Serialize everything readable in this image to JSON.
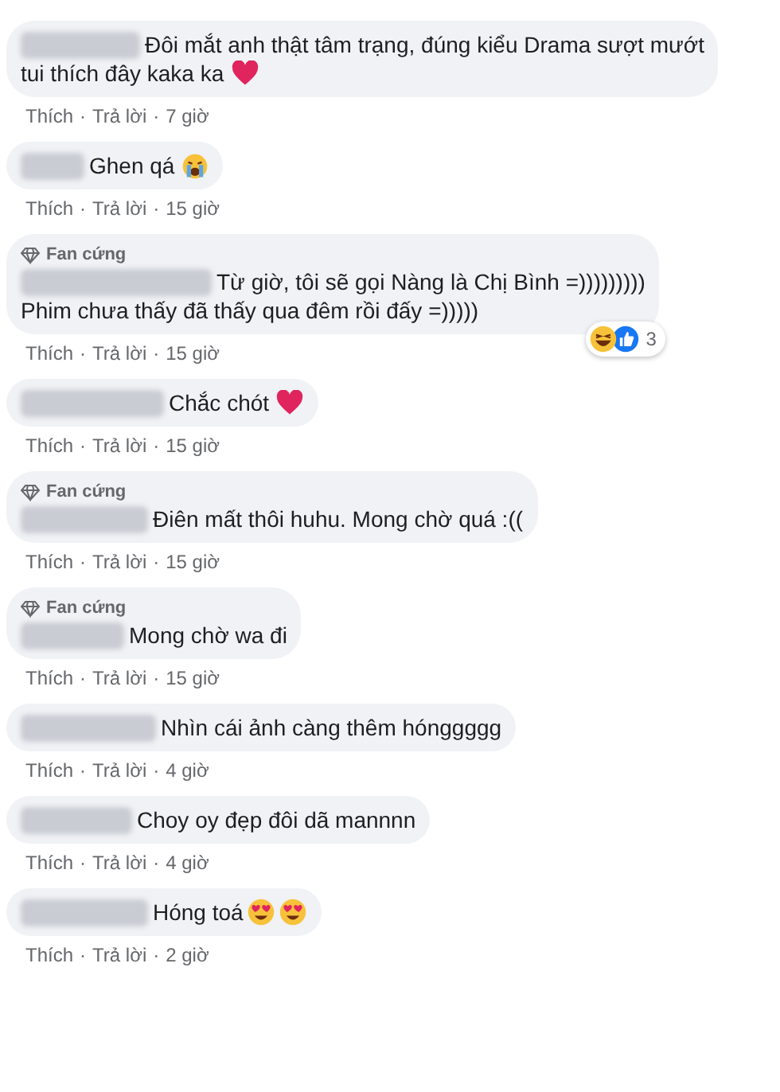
{
  "separator": "·",
  "comments": [
    {
      "lines": [
        "Đôi mắt anh thật tâm trạng, đúng kiểu Drama sượt mướt",
        "tui thích đây kaka ka"
      ],
      "emoji": [
        {
          "kind": "heart"
        }
      ],
      "like": "Thích",
      "reply": "Trả lời",
      "time": "7 giờ"
    },
    {
      "lines": [
        "Ghen qá"
      ],
      "emoji": [
        {
          "kind": "crying"
        }
      ],
      "like": "Thích",
      "reply": "Trả lời",
      "time": "15 giờ"
    },
    {
      "badge": "Fan cứng",
      "lines": [
        "Từ giờ, tôi sẽ gọi Nàng là Chị Bình =)))))))))",
        "Phim chưa thấy đã thấy qua đêm rồi đấy =)))))"
      ],
      "reactions": {
        "kinds": [
          {
            "kind": "haha"
          },
          {
            "kind": "like"
          }
        ],
        "count": "3"
      },
      "like": "Thích",
      "reply": "Trả lời",
      "time": "15 giờ"
    },
    {
      "lines": [
        "Chắc chót"
      ],
      "emoji": [
        {
          "kind": "heart"
        }
      ],
      "like": "Thích",
      "reply": "Trả lời",
      "time": "15 giờ"
    },
    {
      "badge": "Fan cứng",
      "lines": [
        "Điên mất thôi huhu. Mong chờ quá :(("
      ],
      "like": "Thích",
      "reply": "Trả lời",
      "time": "15 giờ"
    },
    {
      "badge": "Fan cứng",
      "lines": [
        "Mong chờ wa đi"
      ],
      "like": "Thích",
      "reply": "Trả lời",
      "time": "15 giờ"
    },
    {
      "lines": [
        "Nhìn cái ảnh càng thêm hónggggg"
      ],
      "like": "Thích",
      "reply": "Trả lời",
      "time": "4 giờ"
    },
    {
      "lines": [
        "Choy oy đẹp đôi dã mannnn"
      ],
      "like": "Thích",
      "reply": "Trả lời",
      "time": "4 giờ"
    },
    {
      "lines": [
        "Hóng toá"
      ],
      "emoji": [
        {
          "kind": "heart_eyes"
        },
        {
          "kind": "heart_eyes"
        }
      ],
      "like": "Thích",
      "reply": "Trả lời",
      "time": "2 giờ"
    }
  ]
}
